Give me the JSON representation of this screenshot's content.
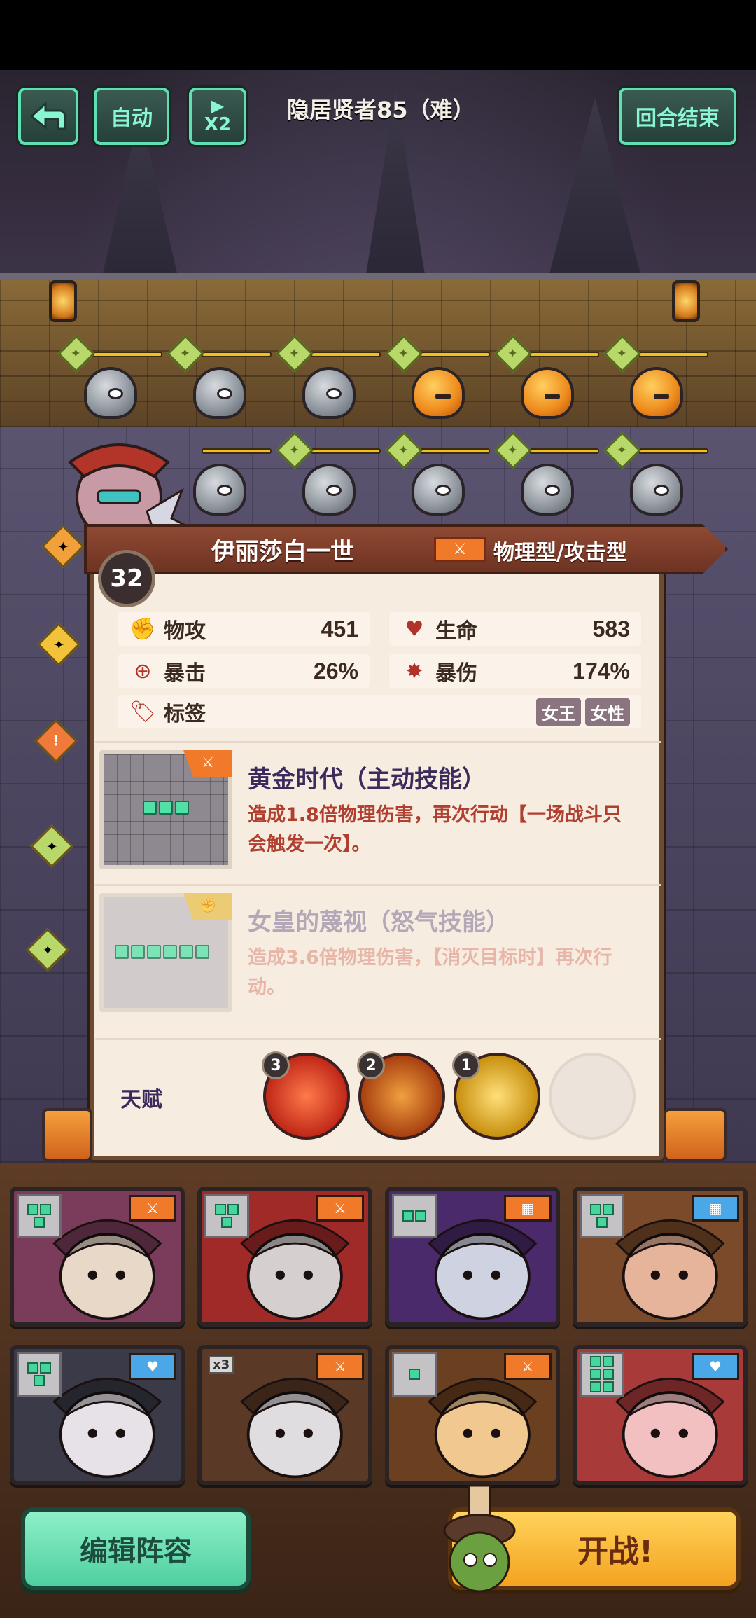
{
  "hud": {
    "back_icon": "back-arrow-icon",
    "auto_label": "自动",
    "speed_label": "X2",
    "stage_title": "隐居贤者85（难）",
    "end_turn_label": "回合结束"
  },
  "hero": {
    "level": "32",
    "name": "伊丽莎白一世",
    "type": "物理型/攻击型",
    "type_icon": "sword-icon",
    "stats": {
      "atk_label": "物攻",
      "atk_value": "451",
      "hp_label": "生命",
      "hp_value": "583",
      "crit_label": "暴击",
      "crit_value": "26%",
      "critdmg_label": "暴伤",
      "critdmg_value": "174%",
      "tags_label": "标签",
      "tags": [
        "女王",
        "女性"
      ]
    },
    "skills": [
      {
        "name": "黄金时代（主动技能）",
        "desc": "造成1.8倍物理伤害，再次行动【一场战斗只会触发一次】。"
      },
      {
        "name": "女皇的蔑视（怒气技能）",
        "desc": "造成3.6倍物理伤害，【消灭目标时】再次行动。"
      }
    ],
    "talent_label": "天赋",
    "talents": [
      {
        "level": "3",
        "icon": "crosshair-icon",
        "color": "#d8331c"
      },
      {
        "level": "2",
        "icon": "chain-icon",
        "color": "#c05a18"
      },
      {
        "level": "1",
        "icon": "fist-icon",
        "color": "#e0b21c"
      }
    ]
  },
  "roster": [
    {
      "role_icon": "sword-icon",
      "role_color": "#f07a2a",
      "shape": 3
    },
    {
      "role_icon": "sword-icon",
      "role_color": "#f07a2a",
      "shape": 3
    },
    {
      "role_icon": "shield-icon",
      "role_color": "#f07a2a",
      "shape": 2
    },
    {
      "role_icon": "shield-icon",
      "role_color": "#4aa8e8",
      "shape": 3
    },
    {
      "role_icon": "heart-icon",
      "role_color": "#4aa8e8",
      "shape": 3
    },
    {
      "role_icon": "sword-icon",
      "role_color": "#f07a2a",
      "shape": 1,
      "badge": "x3"
    },
    {
      "role_icon": "sword-icon",
      "role_color": "#f07a2a",
      "shape": 1
    },
    {
      "role_icon": "heart-icon",
      "role_color": "#4aa8e8",
      "shape": 6
    }
  ],
  "buttons": {
    "edit_lineup": "编辑阵容",
    "start_battle": "开战!"
  }
}
